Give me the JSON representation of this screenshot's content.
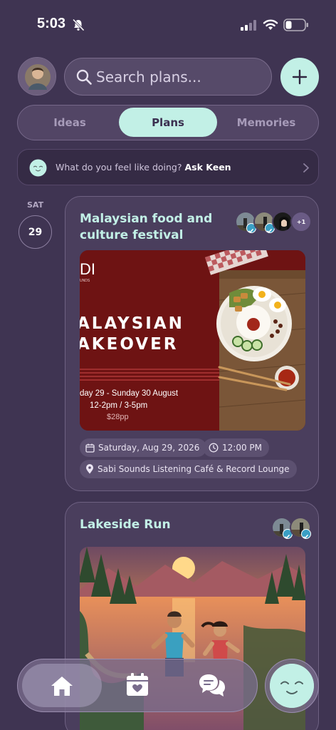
{
  "status_bar": {
    "time": "5:03"
  },
  "search": {
    "placeholder": "Search plans..."
  },
  "tabs": [
    {
      "label": "Ideas",
      "active": false
    },
    {
      "label": "Plans",
      "active": true
    },
    {
      "label": "Memories",
      "active": false
    }
  ],
  "ask_keen": {
    "prompt": "What do you feel like doing?",
    "action": "Ask Keen"
  },
  "date_group": {
    "weekday": "SAT",
    "day": "29"
  },
  "plans": [
    {
      "title_line1": "Malaysian food and",
      "title_line2": "culture festival",
      "attendees_extra": "+1",
      "poster": {
        "brand": "DI",
        "brand_sub": "UNDS",
        "headline_1": "ALAYSIAN",
        "headline_2": "AKEOVER",
        "dates": "day 29 - Sunday 30 August",
        "times": "12-2pm / 3-5pm",
        "price": "$28pp"
      },
      "date": "Saturday, Aug 29, 2026",
      "time": "12:00 PM",
      "location": "Sabi Sounds Listening Café & Record Lounge"
    },
    {
      "title": "Lakeside Run"
    }
  ],
  "colors": {
    "accent": "#c2f0e6",
    "background": "#3f3452",
    "card": "#4a3e5d"
  }
}
